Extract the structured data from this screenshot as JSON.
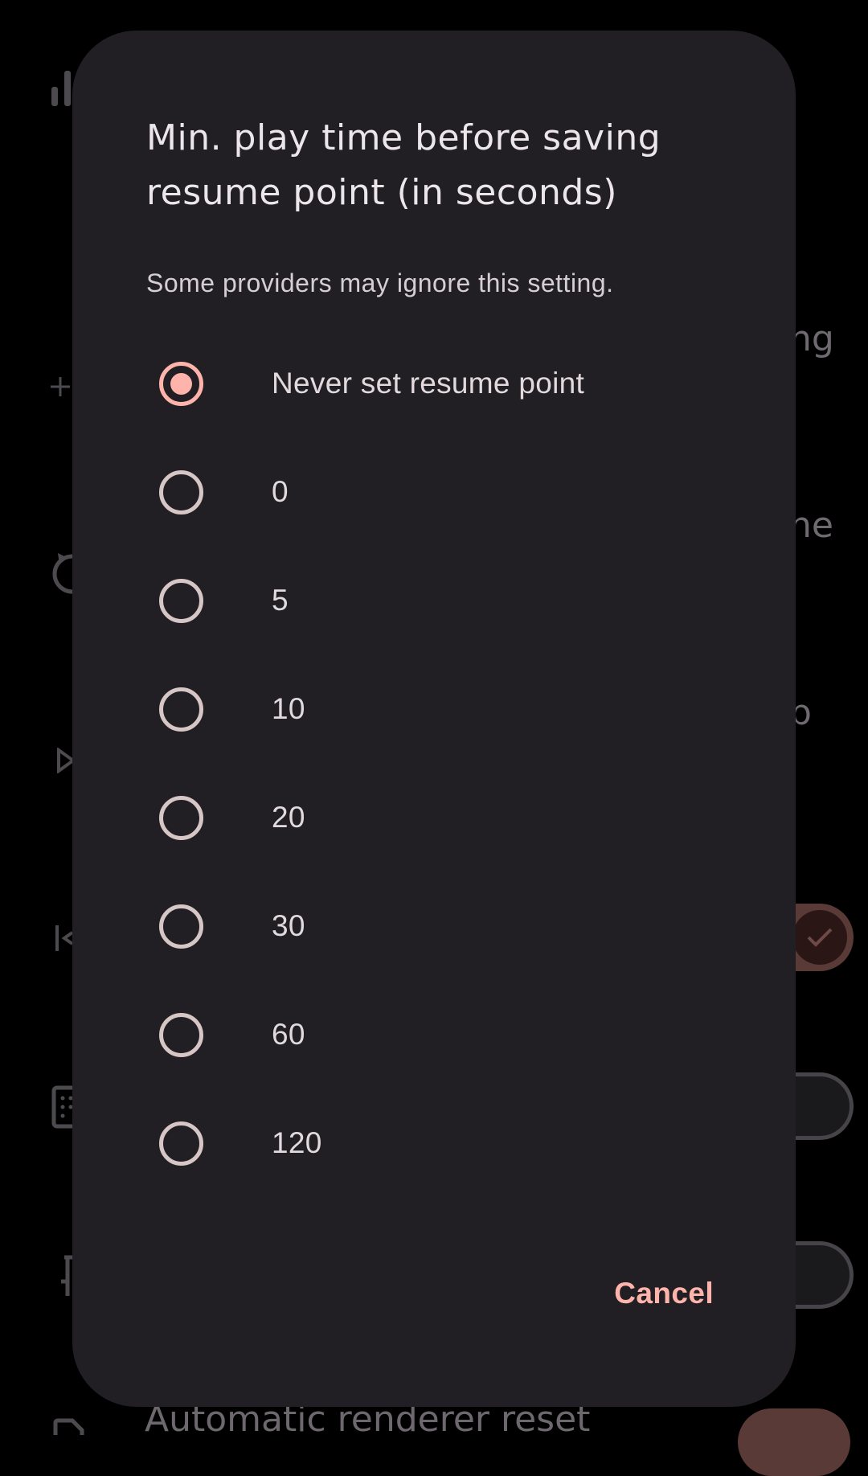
{
  "background_screen": {
    "fragments": [
      "ng",
      "ne",
      "p"
    ],
    "bottom_item_label": "Automatic renderer reset",
    "icons": [
      "stats-icon",
      "add-icon",
      "replay-icon",
      "play-icon",
      "skip-back-icon",
      "grid-icon",
      "pin-icon",
      "document-icon",
      "checkmark-icon"
    ]
  },
  "dialog": {
    "title": "Min. play time before saving resume point (in seconds)",
    "message": "Some providers may ignore this setting.",
    "options": [
      {
        "label": "Never set resume point",
        "selected": true
      },
      {
        "label": "0",
        "selected": false
      },
      {
        "label": "5",
        "selected": false
      },
      {
        "label": "10",
        "selected": false
      },
      {
        "label": "20",
        "selected": false
      },
      {
        "label": "30",
        "selected": false
      },
      {
        "label": "60",
        "selected": false
      },
      {
        "label": "120",
        "selected": false
      }
    ],
    "cancel_label": "Cancel"
  },
  "colors": {
    "accent": "#ffb4ab",
    "dialog_surface": "#211f24",
    "scrim": "#000000"
  }
}
